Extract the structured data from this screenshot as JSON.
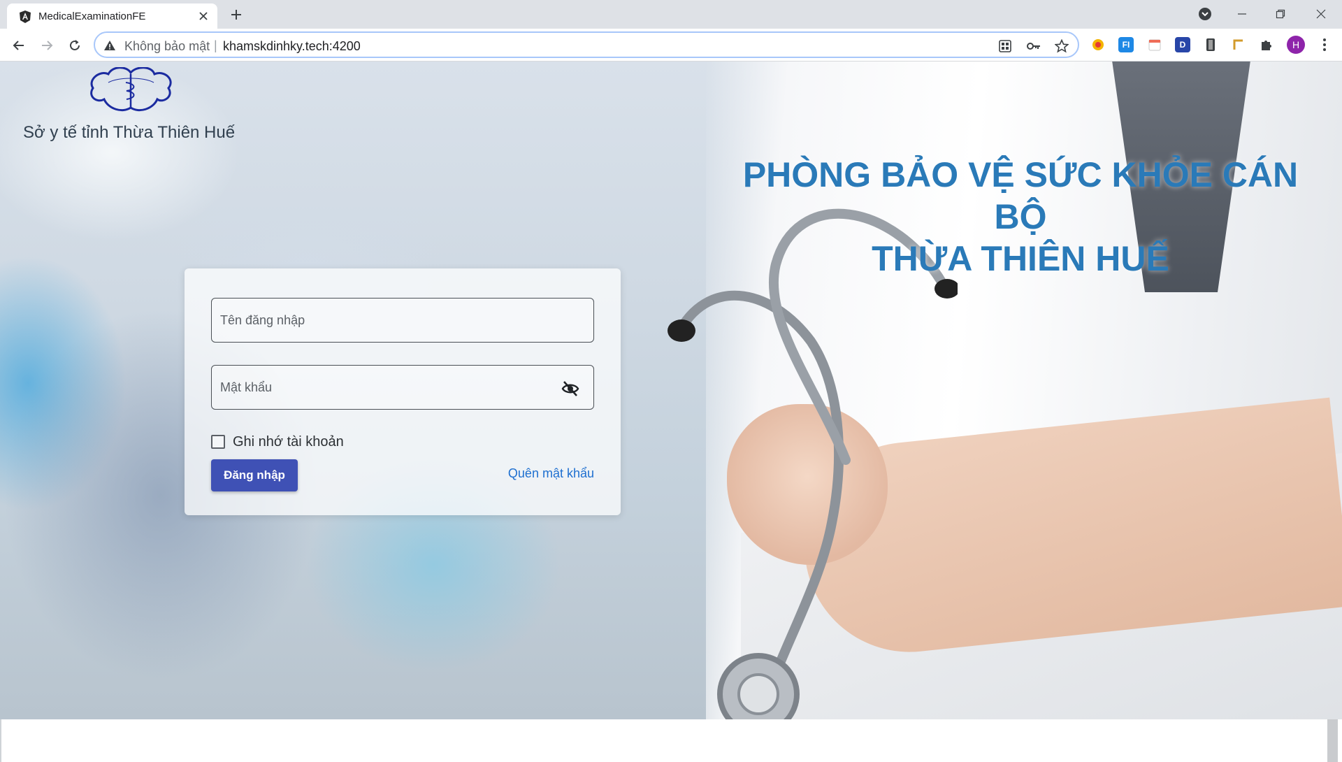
{
  "browser": {
    "tab_title": "MedicalExaminationFE",
    "security_label": "Không bảo mật",
    "url": "khamskdinhky.tech:4200",
    "profile_initial": "H",
    "extensions": [
      "color-picker-icon",
      "fi-extension-icon",
      "calendar-extension-icon",
      "d-extension-icon",
      "clipboard-extension-icon",
      "ruler-extension-icon",
      "puzzle-icon"
    ]
  },
  "page": {
    "org_name": "Sở y tế tỉnh Thừa Thiên Huế",
    "headline_line1": "PHÒNG BẢO VỆ SỨC KHỎE CÁN BỘ",
    "headline_line2": "THỪA THIÊN HUẾ",
    "login": {
      "username_placeholder": "Tên đăng nhập",
      "password_placeholder": "Mật khẩu",
      "remember_label": "Ghi nhớ tài khoản",
      "submit_label": "Đăng nhập",
      "forgot_label": "Quên mật khẩu",
      "remember_checked": false
    }
  },
  "colors": {
    "headline": "#2a7ab8",
    "primary_button": "#3f51b5",
    "link": "#1e6fd0"
  }
}
